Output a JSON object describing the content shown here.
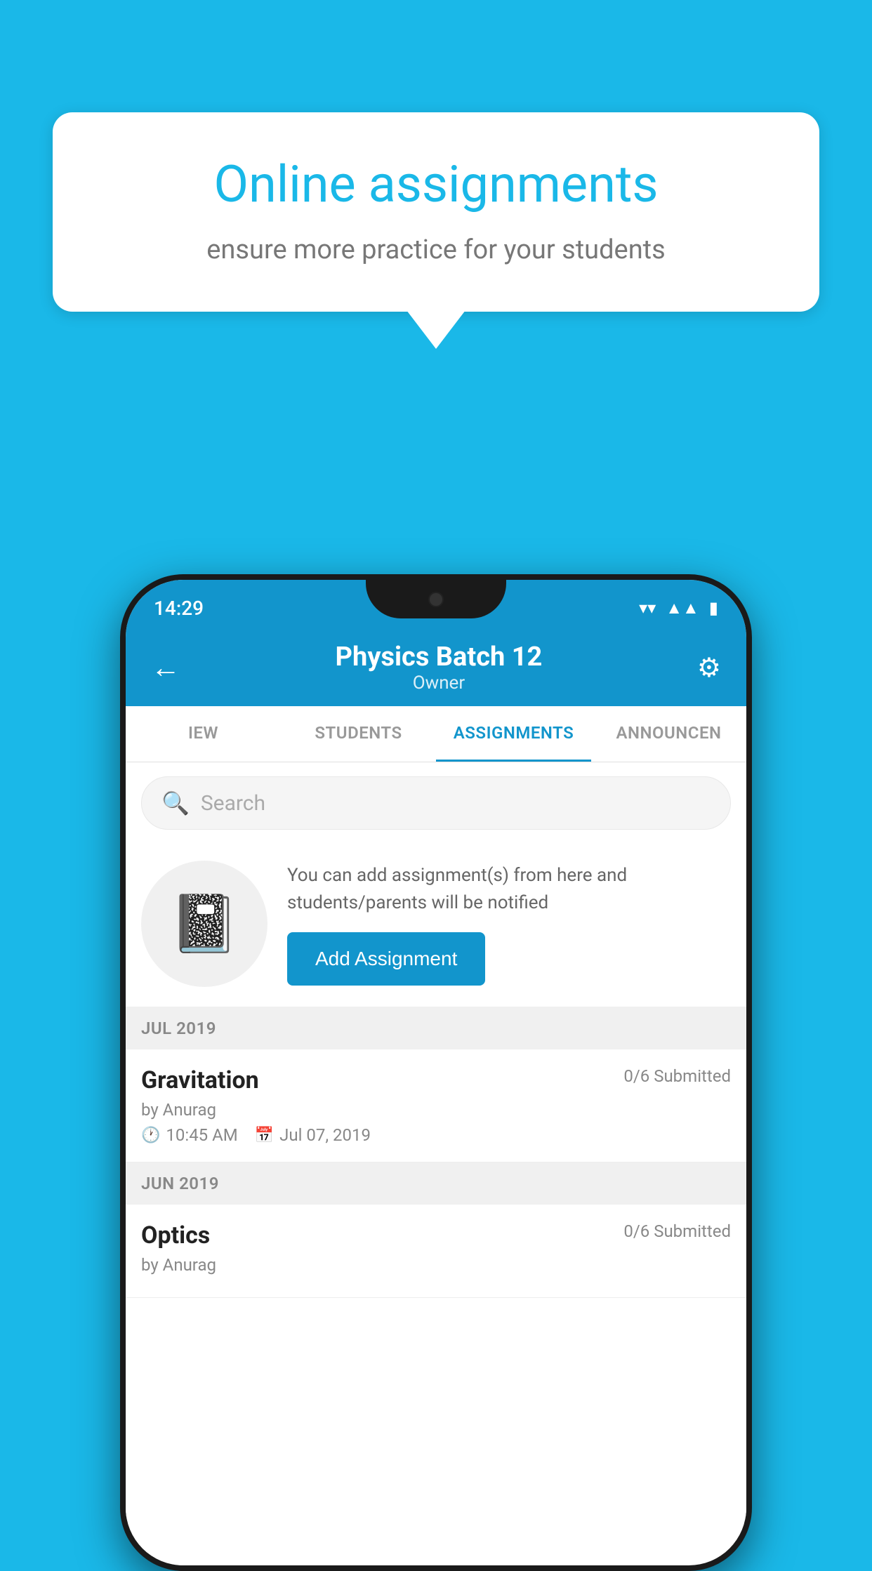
{
  "background_color": "#1ab8e8",
  "speech_bubble": {
    "title": "Online assignments",
    "subtitle": "ensure more practice for your students"
  },
  "status_bar": {
    "time": "14:29",
    "wifi_icon": "wifi",
    "signal_icon": "signal",
    "battery_icon": "battery"
  },
  "header": {
    "title": "Physics Batch 12",
    "subtitle": "Owner",
    "back_label": "←",
    "gear_label": "⚙"
  },
  "tabs": [
    {
      "label": "IEW",
      "active": false
    },
    {
      "label": "STUDENTS",
      "active": false
    },
    {
      "label": "ASSIGNMENTS",
      "active": true
    },
    {
      "label": "ANNOUNCEN",
      "active": false
    }
  ],
  "search": {
    "placeholder": "Search",
    "icon": "🔍"
  },
  "add_assignment": {
    "description": "You can add assignment(s) from here and students/parents will be notified",
    "button_label": "Add Assignment",
    "icon": "📓"
  },
  "sections": [
    {
      "header": "JUL 2019",
      "items": [
        {
          "name": "Gravitation",
          "submitted": "0/6 Submitted",
          "by": "by Anurag",
          "time": "10:45 AM",
          "date": "Jul 07, 2019"
        }
      ]
    },
    {
      "header": "JUN 2019",
      "items": [
        {
          "name": "Optics",
          "submitted": "0/6 Submitted",
          "by": "by Anurag",
          "time": "",
          "date": ""
        }
      ]
    }
  ]
}
